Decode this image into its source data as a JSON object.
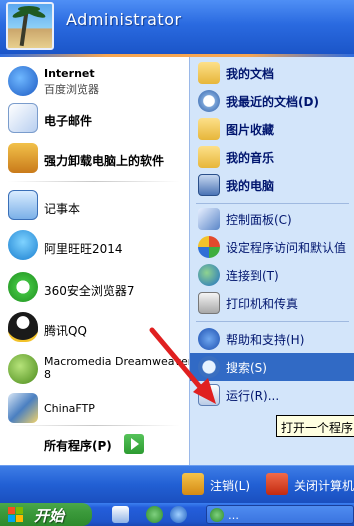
{
  "header": {
    "username": "Administrator"
  },
  "left_pane": {
    "pinned": [
      {
        "label": "Internet",
        "sub": "百度浏览器",
        "icon": "browser-icon"
      },
      {
        "label": "电子邮件",
        "icon": "email-icon"
      },
      {
        "label": "强力卸载电脑上的软件",
        "icon": "uninstall-icon"
      }
    ],
    "recent": [
      {
        "label": "记事本",
        "icon": "notepad-icon"
      },
      {
        "label": "阿里旺旺2014",
        "icon": "aliwangwang-icon"
      },
      {
        "label": "360安全浏览器7",
        "icon": "360-browser-icon"
      },
      {
        "label": "腾讯QQ",
        "icon": "qq-icon"
      },
      {
        "label": "Macromedia Dreamweaver",
        "label2": "8",
        "icon": "dreamweaver-icon"
      },
      {
        "label": "ChinaFTP",
        "icon": "ftp-icon"
      }
    ],
    "all_programs": "所有程序(P)"
  },
  "right_pane": {
    "group1": [
      "我的文档",
      "我最近的文档(D)",
      "图片收藏",
      "我的音乐",
      "我的电脑"
    ],
    "group2": [
      "控制面板(C)",
      "设定程序访问和默认值",
      "连接到(T)",
      "打印机和传真"
    ],
    "group3": [
      "帮助和支持(H)",
      "搜索(S)",
      "运行(R)..."
    ]
  },
  "tooltip": "打开一个程序",
  "footer": {
    "logoff": "注销(L)",
    "shutdown": "关闭计算机"
  },
  "taskbar": {
    "start": "开始",
    "task1": "…"
  }
}
